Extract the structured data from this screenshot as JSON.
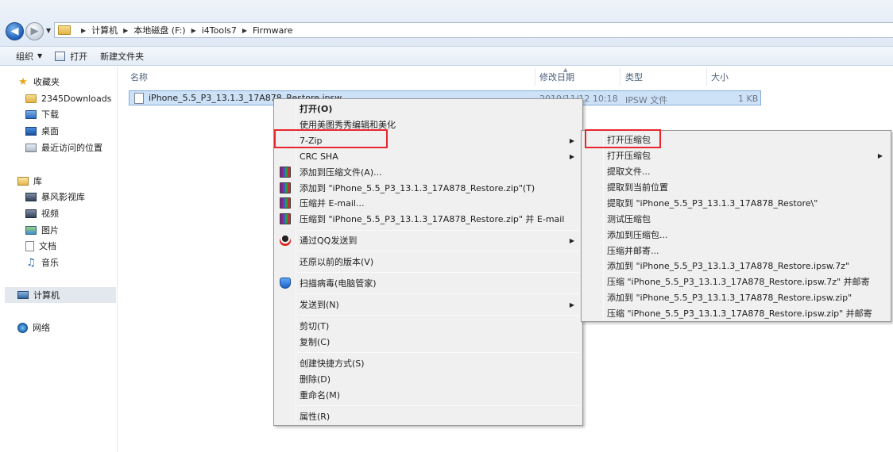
{
  "address_bar": {
    "breadcrumbs": [
      "计算机",
      "本地磁盘 (F:)",
      "i4Tools7",
      "Firmware"
    ]
  },
  "toolbar": {
    "organize": "组织",
    "open": "打开",
    "new_folder": "新建文件夹"
  },
  "sidebar": {
    "favorites": "收藏夹",
    "items_fav": [
      "2345Downloads",
      "下载",
      "桌面",
      "最近访问的位置"
    ],
    "library": "库",
    "items_lib": [
      "暴风影视库",
      "视频",
      "图片",
      "文档",
      "音乐"
    ],
    "computer": "计算机",
    "network": "网络"
  },
  "columns": {
    "name": "名称",
    "date": "修改日期",
    "type": "类型",
    "size": "大小"
  },
  "file": {
    "name": "iPhone_5.5_P3_13.1.3_17A878_Restore.ipsw",
    "date": "2019/11/12 10:18",
    "type": "IPSW 文件",
    "size": "1 KB"
  },
  "context_menu": {
    "open": "打开(O)",
    "meitu": "使用美图秀秀编辑和美化",
    "zip7": "7-Zip",
    "crc": "CRC SHA",
    "add_archive": "添加到压缩文件(A)...",
    "add_to_zip": "添加到 \"iPhone_5.5_P3_13.1.3_17A878_Restore.zip\"(T)",
    "compress_email": "压缩并 E-mail...",
    "compress_to_email": "压缩到 \"iPhone_5.5_P3_13.1.3_17A878_Restore.zip\" 并 E-mail",
    "qq_send": "通过QQ发送到",
    "restore_prev": "还原以前的版本(V)",
    "scan_virus": "扫描病毒(电脑管家)",
    "send_to": "发送到(N)",
    "cut": "剪切(T)",
    "copy": "复制(C)",
    "create_shortcut": "创建快捷方式(S)",
    "delete": "删除(D)",
    "rename": "重命名(M)",
    "properties": "属性(R)"
  },
  "submenu_7zip": {
    "open_archive": "打开压缩包",
    "open_archive_sub": "打开压缩包",
    "extract_files": "提取文件...",
    "extract_here": "提取到当前位置",
    "extract_to": "提取到 \"iPhone_5.5_P3_13.1.3_17A878_Restore\\\"",
    "test_archive": "测试压缩包",
    "add_to_archive": "添加到压缩包...",
    "compress_email": "压缩并邮寄...",
    "add_to_7z": "添加到 \"iPhone_5.5_P3_13.1.3_17A878_Restore.ipsw.7z\"",
    "compress_7z_email": "压缩 \"iPhone_5.5_P3_13.1.3_17A878_Restore.ipsw.7z\" 并邮寄",
    "add_to_zip": "添加到 \"iPhone_5.5_P3_13.1.3_17A878_Restore.ipsw.zip\"",
    "compress_zip_email": "压缩 \"iPhone_5.5_P3_13.1.3_17A878_Restore.ipsw.zip\" 并邮寄"
  },
  "colors": {
    "highlight_box": "#e8262b",
    "selection": "#cde1f7"
  }
}
